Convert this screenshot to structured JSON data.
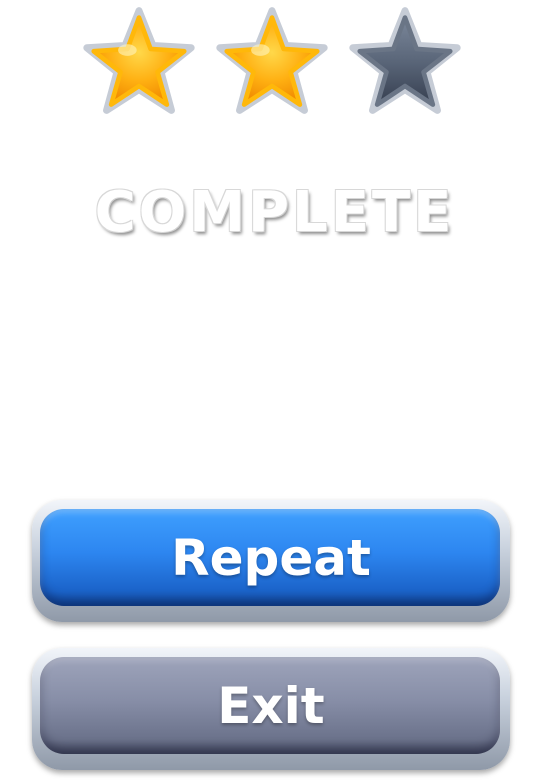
{
  "rating": {
    "earned_stars": 2,
    "max_stars": 3,
    "stars": [
      {
        "state": "filled",
        "color": "#ffa500"
      },
      {
        "state": "filled",
        "color": "#ffa500"
      },
      {
        "state": "empty",
        "color": "#4a5668"
      }
    ]
  },
  "title": "COMPLETE",
  "buttons": {
    "repeat_label": "Repeat",
    "exit_label": "Exit"
  },
  "colors": {
    "repeat_button": "#2d86f0",
    "exit_button": "#878ea7",
    "star_gold": "#ffa500",
    "star_empty": "#4a5668"
  }
}
